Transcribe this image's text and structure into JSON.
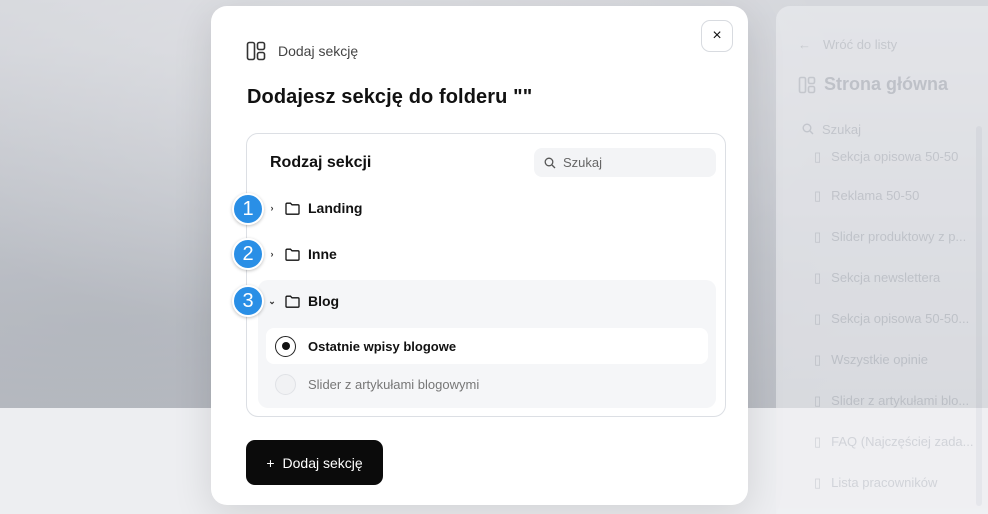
{
  "background": {
    "panel": {
      "back_label": "Wróć do listy",
      "title": "Strona główna",
      "search_placeholder": "Szukaj",
      "items": [
        "Sekcja opisowa 50-50",
        "Reklama 50-50",
        "Slider produktowy z p...",
        "Sekcja newslettera",
        "Sekcja opisowa 50-50...",
        "Wszystkie opinie",
        "Slider z artykułami blo...",
        "FAQ (Najczęściej zada...",
        "Lista pracowników"
      ]
    }
  },
  "modal": {
    "header_label": "Dodaj sekcję",
    "close_label": "×",
    "title": "Dodajesz sekcję do folderu \"\"",
    "section_type_label": "Rodzaj sekcji",
    "search_placeholder": "Szukaj",
    "folders": [
      {
        "label": "Landing",
        "expanded": false,
        "marker": "1"
      },
      {
        "label": "Inne",
        "expanded": false,
        "marker": "2"
      },
      {
        "label": "Blog",
        "expanded": true,
        "marker": "3"
      }
    ],
    "blog_options": [
      {
        "label": "Ostatnie wpisy blogowe",
        "selected": true
      },
      {
        "label": "Slider z artykułami blogowymi",
        "selected": false
      }
    ],
    "add_button_label": "Dodaj sekcję",
    "add_button_icon": "+"
  },
  "colors": {
    "marker": "#2a8fe6",
    "primary_button": "#0b0b0b"
  }
}
